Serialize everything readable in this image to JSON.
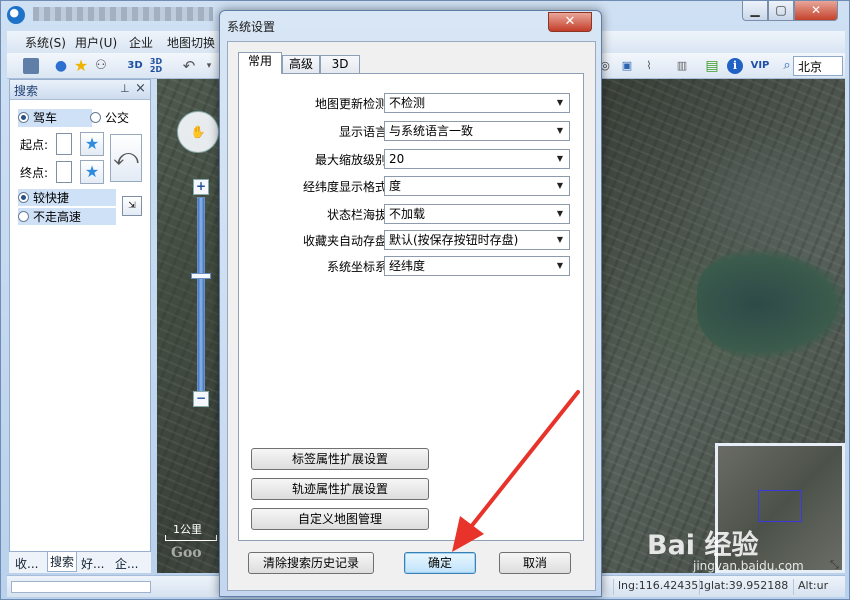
{
  "menubar": {
    "items": [
      "系统(S)",
      "用户(U)",
      "企业",
      "地图切换"
    ]
  },
  "toolbar": {
    "city": "北京",
    "vip_label": "VIP",
    "info_label": "i",
    "three_d_label": "3D",
    "three_d_2d_label": "3D\n2D"
  },
  "left_panel": {
    "title": "搜索",
    "mode_drive": "驾车",
    "mode_bus": "公交",
    "start_label": "起点:",
    "end_label": "终点:",
    "route_fast": "较快捷",
    "route_no_highway": "不走高速",
    "tabs": [
      "收...",
      "搜索",
      "好...",
      "企..."
    ]
  },
  "map": {
    "scale_text": "1公里",
    "watermark": "Bai 经验",
    "watermark_sub": "jingyan.baidu.com",
    "google": "Goo"
  },
  "status": {
    "lng": "lng:116.424351",
    "lat": "glat:39.952188",
    "alt": "Alt:ur"
  },
  "dialog": {
    "title": "系统设置",
    "tabs": [
      "常用",
      "高级",
      "3D"
    ],
    "settings": [
      {
        "label": "地图更新检测",
        "value": "不检测"
      },
      {
        "label": "显示语言",
        "value": "与系统语言一致"
      },
      {
        "label": "最大缩放级别",
        "value": "20"
      },
      {
        "label": "经纬度显示格式",
        "value": "度"
      },
      {
        "label": "状态栏海拔",
        "value": "不加载"
      },
      {
        "label": "收藏夹自动存盘",
        "value": "默认(按保存按钮时存盘)"
      },
      {
        "label": "系统坐标系",
        "value": "经纬度"
      }
    ],
    "buttons": {
      "tag_ext": "标签属性扩展设置",
      "track_ext": "轨迹属性扩展设置",
      "custom_map": "自定义地图管理",
      "clear_history": "清除搜索历史记录",
      "ok": "确定",
      "cancel": "取消"
    }
  },
  "colors": {
    "accent": "#1f62c4",
    "annotation_arrow": "#e8332b",
    "dialog_close": "#c43e2a"
  }
}
